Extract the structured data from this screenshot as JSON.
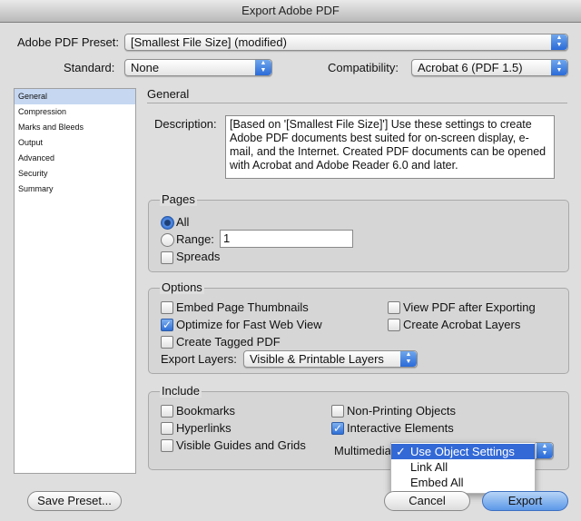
{
  "window": {
    "title": "Export Adobe PDF"
  },
  "preset": {
    "label": "Adobe PDF Preset:",
    "value": "[Smallest File Size] (modified)"
  },
  "standard": {
    "label": "Standard:",
    "value": "None"
  },
  "compatibility": {
    "label": "Compatibility:",
    "value": "Acrobat 6 (PDF 1.5)"
  },
  "sidebar": {
    "items": [
      {
        "label": "General",
        "selected": true
      },
      {
        "label": "Compression",
        "selected": false
      },
      {
        "label": "Marks and Bleeds",
        "selected": false
      },
      {
        "label": "Output",
        "selected": false
      },
      {
        "label": "Advanced",
        "selected": false
      },
      {
        "label": "Security",
        "selected": false
      },
      {
        "label": "Summary",
        "selected": false
      }
    ]
  },
  "general": {
    "title": "General",
    "description_label": "Description:",
    "description": "[Based on '[Smallest File Size]'] Use these settings to create Adobe PDF documents best suited for on-screen display, e-mail, and the Internet.  Created PDF documents can be opened with Acrobat and Adobe Reader 6.0 and later."
  },
  "pages": {
    "title": "Pages",
    "all_label": "All",
    "all_selected": true,
    "range_label": "Range:",
    "range_value": "1",
    "spreads_label": "Spreads",
    "spreads_checked": false
  },
  "options": {
    "title": "Options",
    "embed_thumbnails": {
      "label": "Embed Page Thumbnails",
      "checked": false
    },
    "optimize_web": {
      "label": "Optimize for Fast Web View",
      "checked": true
    },
    "tagged_pdf": {
      "label": "Create Tagged PDF",
      "checked": false
    },
    "view_after": {
      "label": "View PDF after Exporting",
      "checked": false
    },
    "acrobat_layers": {
      "label": "Create Acrobat Layers",
      "checked": false
    },
    "export_layers_label": "Export Layers:",
    "export_layers_value": "Visible & Printable Layers"
  },
  "include": {
    "title": "Include",
    "bookmarks": {
      "label": "Bookmarks",
      "checked": false
    },
    "hyperlinks": {
      "label": "Hyperlinks",
      "checked": false
    },
    "guides": {
      "label": "Visible Guides and Grids",
      "checked": false
    },
    "non_printing": {
      "label": "Non-Printing Objects",
      "checked": false
    },
    "interactive": {
      "label": "Interactive Elements",
      "checked": true
    },
    "multimedia_label": "Multimedia:"
  },
  "multimedia_menu": {
    "items": [
      {
        "label": "Use Object Settings",
        "selected": true
      },
      {
        "label": "Link All",
        "selected": false
      },
      {
        "label": "Embed All",
        "selected": false
      }
    ]
  },
  "buttons": {
    "save_preset": "Save Preset...",
    "cancel": "Cancel",
    "export": "Export"
  },
  "colors": {
    "accent": "#3369d6",
    "selection_light": "#c5d7f1"
  }
}
